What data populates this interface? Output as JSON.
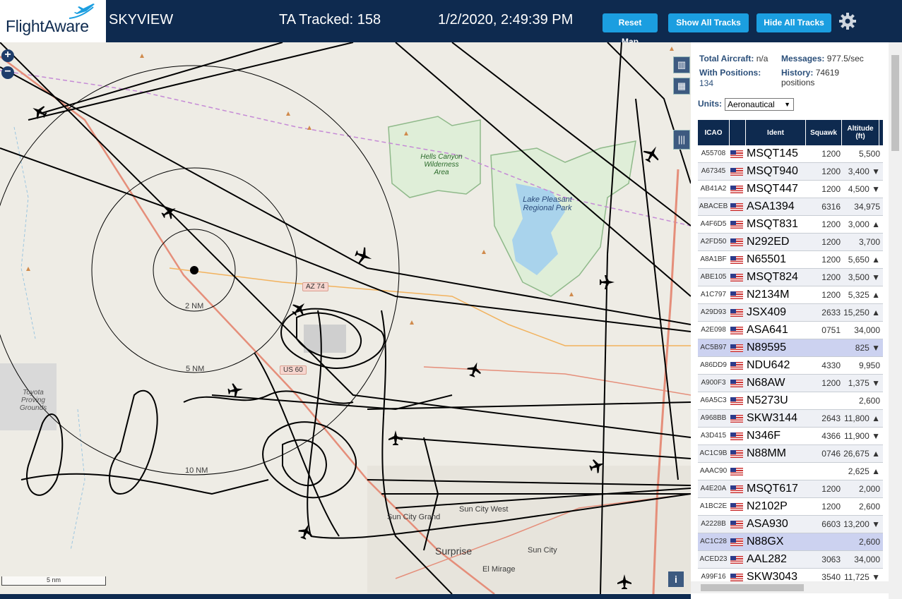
{
  "header": {
    "logo_text": "FlightAware",
    "app_title": "SKYVIEW",
    "tracked": "TA Tracked: 158",
    "clock": "1/2/2020, 2:49:39 PM",
    "reset_label": "Reset Map",
    "show_label": "Show All Tracks",
    "hide_label": "Hide All Tracks",
    "settings_icon": "gear-icon"
  },
  "map": {
    "zoom_in": "+",
    "zoom_out": "−",
    "range_rings": [
      "2 NM",
      "5 NM",
      "10 NM"
    ],
    "scale_label": "5 nm",
    "labels": {
      "az74": "AZ 74",
      "us60": "US 60",
      "hells_canyon": "Hells Canyon Wilderness Area",
      "lake_pleasant": "Lake Pleasant Regional Park",
      "toyota": "Toyota Proving Grounds",
      "sun_city_grand": "Sun City Grand",
      "sun_city_west": "Sun City West",
      "sun_city": "Sun City",
      "surprise": "Surprise",
      "el_mirage": "El Mirage"
    },
    "info_icon": "i"
  },
  "sidebar": {
    "total_aircraft_label": "Total Aircraft:",
    "total_aircraft_value": "n/a",
    "with_positions_label": "With Positions:",
    "with_positions_value": "134",
    "messages_label": "Messages:",
    "messages_value": "977.5/sec",
    "history_label": "History:",
    "history_value": "74619 positions",
    "units_label": "Units:",
    "units_value": "Aeronautical",
    "columns": {
      "icao": "ICAO",
      "ident": "Ident",
      "squawk": "Squawk",
      "altitude": "Altitude (ft)"
    },
    "rows": [
      {
        "icao": "A55708",
        "ident": "MSQT145",
        "squawk": "1200",
        "alt": "5,500"
      },
      {
        "icao": "A67345",
        "ident": "MSQT940",
        "squawk": "1200",
        "alt": "3,400 ▼"
      },
      {
        "icao": "AB41A2",
        "ident": "MSQT447",
        "squawk": "1200",
        "alt": "4,500 ▼"
      },
      {
        "icao": "ABACEB",
        "ident": "ASA1394",
        "squawk": "6316",
        "alt": "34,975"
      },
      {
        "icao": "A4F6D5",
        "ident": "MSQT831",
        "squawk": "1200",
        "alt": "3,000 ▲"
      },
      {
        "icao": "A2FD50",
        "ident": "N292ED",
        "squawk": "1200",
        "alt": "3,700"
      },
      {
        "icao": "A8A1BF",
        "ident": "N65501",
        "squawk": "1200",
        "alt": "5,650 ▲"
      },
      {
        "icao": "ABE105",
        "ident": "MSQT824",
        "squawk": "1200",
        "alt": "3,500 ▼"
      },
      {
        "icao": "A1C797",
        "ident": "N2134M",
        "squawk": "1200",
        "alt": "5,325 ▲"
      },
      {
        "icao": "A29D93",
        "ident": "JSX409",
        "squawk": "2633",
        "alt": "15,250 ▲"
      },
      {
        "icao": "A2E098",
        "ident": "ASA641",
        "squawk": "0751",
        "alt": "34,000"
      },
      {
        "icao": "AC5B97",
        "ident": "N89595",
        "squawk": "",
        "alt": "825 ▼"
      },
      {
        "icao": "A86DD9",
        "ident": "NDU642",
        "squawk": "4330",
        "alt": "9,950"
      },
      {
        "icao": "A900F3",
        "ident": "N68AW",
        "squawk": "1200",
        "alt": "1,375 ▼"
      },
      {
        "icao": "A6A5C3",
        "ident": "N5273U",
        "squawk": "",
        "alt": "2,600"
      },
      {
        "icao": "A968BB",
        "ident": "SKW3144",
        "squawk": "2643",
        "alt": "11,800 ▲"
      },
      {
        "icao": "A3D415",
        "ident": "N346F",
        "squawk": "4366",
        "alt": "11,900 ▼"
      },
      {
        "icao": "AC1C9B",
        "ident": "N88MM",
        "squawk": "0746",
        "alt": "26,675 ▲"
      },
      {
        "icao": "AAAC90",
        "ident": "",
        "squawk": "",
        "alt": "2,625 ▲"
      },
      {
        "icao": "A4E20A",
        "ident": "MSQT617",
        "squawk": "1200",
        "alt": "2,000"
      },
      {
        "icao": "A1BC2E",
        "ident": "N2102P",
        "squawk": "1200",
        "alt": "2,600"
      },
      {
        "icao": "A2228B",
        "ident": "ASA930",
        "squawk": "6603",
        "alt": "13,200 ▼"
      },
      {
        "icao": "AC1C28",
        "ident": "N88GX",
        "squawk": "",
        "alt": "2,600"
      },
      {
        "icao": "ACED23",
        "ident": "AAL282",
        "squawk": "3063",
        "alt": "34,000"
      },
      {
        "icao": "A99F16",
        "ident": "SKW3043",
        "squawk": "3540",
        "alt": "11,725 ▼"
      }
    ]
  }
}
